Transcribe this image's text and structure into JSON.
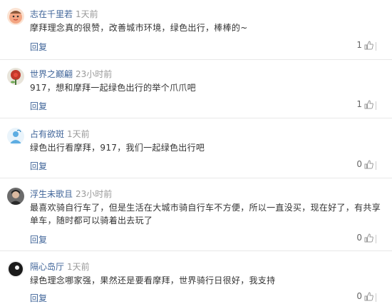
{
  "comments": [
    {
      "user": "志在千里若",
      "time": "1天前",
      "text": "摩拜理念真的很赞，改善城市环境，绿色出行，棒棒的~",
      "reply": "回复",
      "likes": "1",
      "avatar_icon": "cartoon-face-avatar",
      "avatar_color": "#f3a683"
    },
    {
      "user": "世界之巅翩",
      "time": "23小时前",
      "text": "917，想和摩拜一起绿色出行的举个爪爪吧",
      "reply": "回复",
      "likes": "1",
      "avatar_icon": "red-flower-avatar",
      "avatar_color": "#c0392b"
    },
    {
      "user": "占有欲斑",
      "time": "1天前",
      "text": "绿色出行看摩拜，917，我们一起绿色出行吧",
      "reply": "回复",
      "likes": "0",
      "avatar_icon": "blue-figure-avatar",
      "avatar_color": "#5dade2"
    },
    {
      "user": "浮生未歌且",
      "time": "23小时前",
      "text": "最喜欢骑自行车了，但是生活在大城市骑自行车不方便，所以一直没买，现在好了，有共享单车，随时都可以骑着出去玩了",
      "reply": "回复",
      "likes": "0",
      "avatar_icon": "dark-portrait-avatar",
      "avatar_color": "#3d3d3d"
    },
    {
      "user": "隔心岛厅",
      "time": "1天前",
      "text": "绿色理念哪家强，果然还是要看摩拜，世界骑行日很好，我支持",
      "reply": "回复",
      "likes": "0",
      "avatar_icon": "black-silhouette-avatar",
      "avatar_color": "#1a1a1a"
    }
  ]
}
